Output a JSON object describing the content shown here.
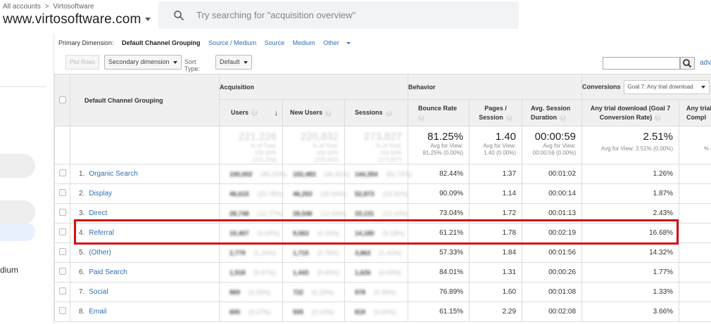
{
  "header": {
    "crumb_all": "All accounts",
    "crumb_sep": ">",
    "crumb_account": "Virtosoftware",
    "property": "www.virtosoftware.com",
    "search_placeholder": "Try searching for \"acquisition overview\""
  },
  "leftnav": {
    "partial_label": "dium"
  },
  "dimensions": {
    "label": "Primary Dimension:",
    "current": "Default Channel Grouping",
    "options": [
      "Source / Medium",
      "Source",
      "Medium",
      "Other"
    ]
  },
  "controls": {
    "plot_rows": "Plot Rows",
    "secondary_dimension": "Secondary dimension",
    "sort_type_label": "Sort Type:",
    "sort_type_value": "Default",
    "advanced": "adva"
  },
  "table": {
    "group_headers": {
      "dimension": "Default Channel Grouping",
      "acquisition": "Acquisition",
      "behavior": "Behavior",
      "conversions": "Conversions",
      "goal_select": "Goal 7: Any trial download"
    },
    "columns": {
      "users": "Users",
      "new_users": "New Users",
      "sessions": "Sessions",
      "bounce_rate": "Bounce Rate",
      "pages_session_1": "Pages /",
      "pages_session_2": "Session",
      "avg_session_1": "Avg. Session",
      "avg_session_2": "Duration",
      "goal_conv_1": "Any trial download (Goal 7",
      "goal_conv_2": "Conversion Rate)",
      "goal_comp_1": "Any trial d",
      "goal_comp_2": "Compl"
    },
    "totals": {
      "users": "221,226",
      "users_sub1": "% of Total:",
      "users_sub2": "100.00%",
      "users_sub3": "(221,226)",
      "new_users": "220,832",
      "new_users_sub1": "% of Total:",
      "new_users_sub2": "100.00%",
      "new_users_sub3": "(220,832)",
      "sessions": "273,827",
      "sessions_sub1": "% of Total:",
      "sessions_sub2": "100.00%",
      "sessions_sub3": "(273,827)",
      "bounce_rate": "81.25%",
      "bounce_sub1": "Avg for View:",
      "bounce_sub2": "81.25% (0.00%)",
      "pages": "1.40",
      "pages_sub1": "Avg for View:",
      "pages_sub2": "1.40 (0.00%)",
      "duration": "00:00:59",
      "duration_sub1": "Avg for View:",
      "duration_sub2": "00:00:59 (0.00%)",
      "conv_rate": "2.51%",
      "conv_sub": "Avg for View: 2.51% (0.00%)",
      "completions_sub": "% of Tota"
    },
    "rows": [
      {
        "idx": "1.",
        "channel": "Organic Search",
        "users": "100,002",
        "users_pct": "(45.20%)",
        "new_users": "102,483",
        "new_users_pct": "(46.41%)",
        "sessions": "144,354",
        "sessions_pct": "(52.72%)",
        "bounce": "82.44%",
        "pages": "1.37",
        "duration": "00:01:02",
        "conv": "1.26%"
      },
      {
        "idx": "2.",
        "channel": "Display",
        "users": "46,615",
        "users_pct": "(20.78%)",
        "new_users": "46,253",
        "new_users_pct": "(20.94%)",
        "sessions": "52,873",
        "sessions_pct": "(19.31%)",
        "bounce": "90.09%",
        "pages": "1.14",
        "duration": "00:00:14",
        "conv": "1.87%"
      },
      {
        "idx": "3.",
        "channel": "Direct",
        "users": "28,748",
        "users_pct": "(12.77%)",
        "new_users": "28,548",
        "new_users_pct": "(12.93%)",
        "sessions": "33,131",
        "sessions_pct": "(12.10%)",
        "bounce": "73.04%",
        "pages": "1.72",
        "duration": "00:01:13",
        "conv": "2.43%"
      },
      {
        "idx": "4.",
        "channel": "Referral",
        "users": "10,407",
        "users_pct": "(4.64%)",
        "new_users": "9,063",
        "new_users_pct": "(4.10%)",
        "sessions": "14,180",
        "sessions_pct": "(5.18%)",
        "bounce": "61.21%",
        "pages": "1.78",
        "duration": "00:02:19",
        "conv": "16.68%"
      },
      {
        "idx": "5.",
        "channel": "(Other)",
        "users": "2,779",
        "users_pct": "(1.24%)",
        "new_users": "1,715",
        "new_users_pct": "(0.78%)",
        "sessions": "3,863",
        "sessions_pct": "(1.41%)",
        "bounce": "57.33%",
        "pages": "1.84",
        "duration": "00:01:56",
        "conv": "14.32%"
      },
      {
        "idx": "6.",
        "channel": "Paid Search",
        "users": "1,518",
        "users_pct": "(0.67%)",
        "new_users": "1,443",
        "new_users_pct": "(0.65%)",
        "sessions": "1,626",
        "sessions_pct": "(0.59%)",
        "bounce": "84.01%",
        "pages": "1.31",
        "duration": "00:00:26",
        "conv": "1.77%"
      },
      {
        "idx": "7.",
        "channel": "Social",
        "users": "869",
        "users_pct": "(0.39%)",
        "new_users": "722",
        "new_users_pct": "(0.33%)",
        "sessions": "978",
        "sessions_pct": "(0.36%)",
        "bounce": "76.89%",
        "pages": "1.60",
        "duration": "00:01:08",
        "conv": "1.33%"
      },
      {
        "idx": "8.",
        "channel": "Email",
        "users": "600",
        "users_pct": "(0.27%)",
        "new_users": "505",
        "new_users_pct": "(0.23%)",
        "sessions": "819",
        "sessions_pct": "(0.30%)",
        "bounce": "61.15%",
        "pages": "2.29",
        "duration": "00:02:08",
        "conv": "3.66%"
      }
    ]
  },
  "highlight": {
    "color": "#d40f14",
    "row": "Referral"
  }
}
